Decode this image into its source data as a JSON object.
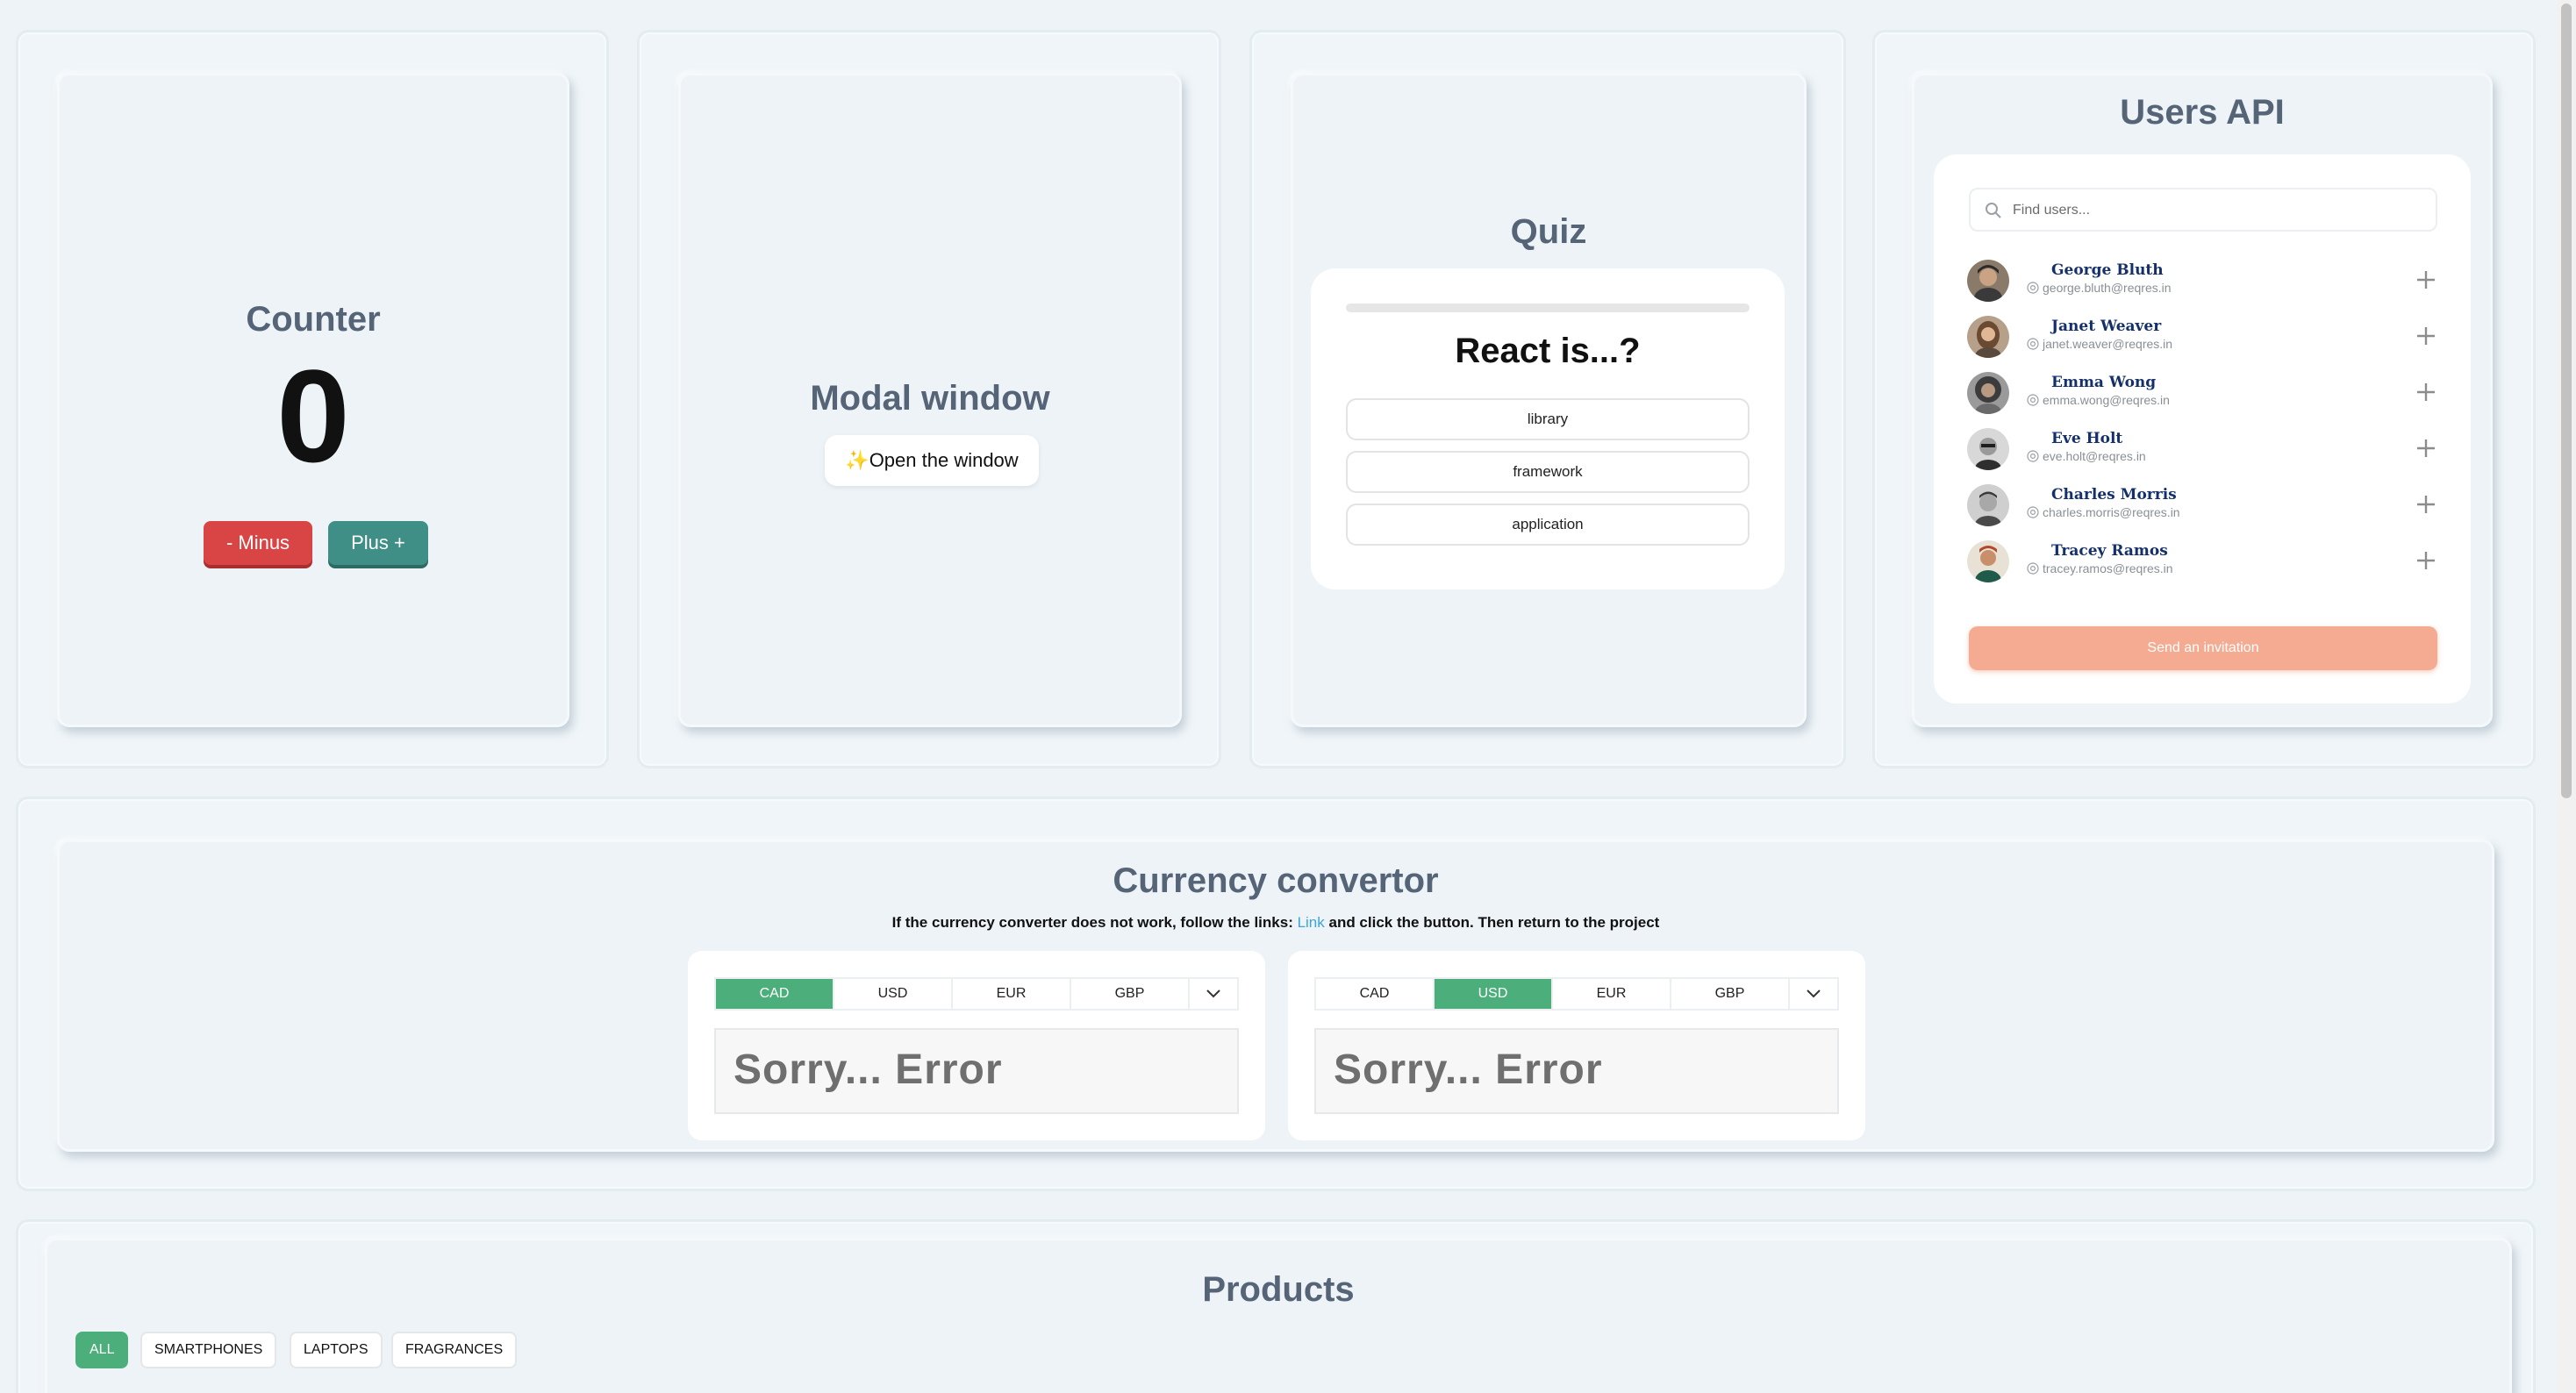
{
  "counter": {
    "title": "Counter",
    "value": "0",
    "minus_label": "- Minus",
    "plus_label": "Plus +"
  },
  "modal": {
    "title": "Modal window",
    "open_label": "✨Open the window"
  },
  "quiz": {
    "title": "Quiz",
    "question": "React is...?",
    "options": [
      "library",
      "framework",
      "application"
    ]
  },
  "users": {
    "title": "Users API",
    "search_placeholder": "Find users...",
    "list": [
      {
        "name": "George Bluth",
        "email": "george.bluth@reqres.in"
      },
      {
        "name": "Janet Weaver",
        "email": "janet.weaver@reqres.in"
      },
      {
        "name": "Emma Wong",
        "email": "emma.wong@reqres.in"
      },
      {
        "name": "Eve Holt",
        "email": "eve.holt@reqres.in"
      },
      {
        "name": "Charles Morris",
        "email": "charles.morris@reqres.in"
      },
      {
        "name": "Tracey Ramos",
        "email": "tracey.ramos@reqres.in"
      }
    ],
    "invite_label": "Send an invitation"
  },
  "currency": {
    "title": "Currency convertor",
    "note_before": "If the currency converter does not work, follow the links: ",
    "note_link": "Link",
    "note_after": " and click the button. Then return to the project",
    "currencies": [
      "CAD",
      "USD",
      "EUR",
      "GBP"
    ],
    "from": {
      "selected": "CAD",
      "value": "Sorry... Error"
    },
    "to": {
      "selected": "USD",
      "value": "Sorry... Error"
    }
  },
  "products": {
    "title": "Products",
    "categories": [
      "ALL",
      "SMARTPHONES",
      "LAPTOPS",
      "FRAGRANCES"
    ],
    "active_category": "ALL"
  },
  "colors": {
    "heading": "#566478",
    "accent_green": "#4caf7b",
    "minus_red": "#d94545",
    "plus_teal": "#3f8f86",
    "invite_salmon": "#f4ab91"
  }
}
